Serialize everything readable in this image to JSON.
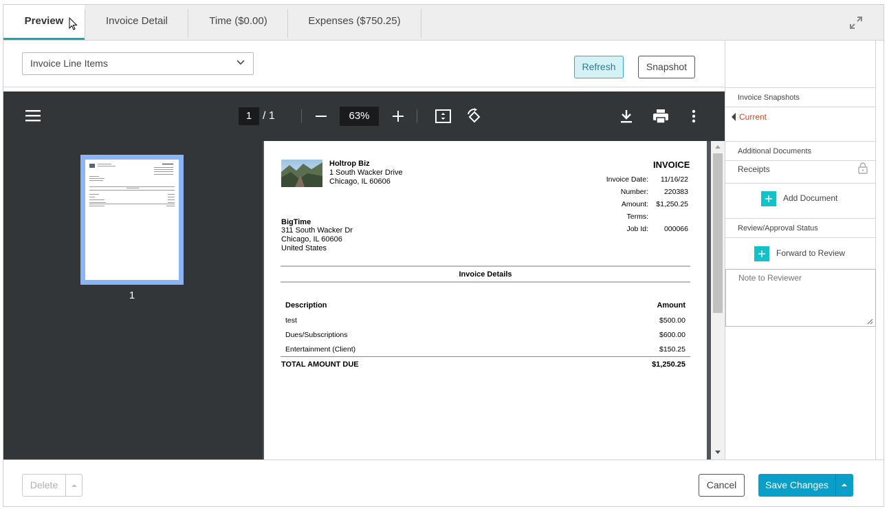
{
  "tabs": [
    {
      "label": "Preview"
    },
    {
      "label": "Invoice Detail"
    },
    {
      "label": "Time ($0.00)"
    },
    {
      "label": "Expenses ($750.25)"
    }
  ],
  "toolbar": {
    "view_select": "Invoice Line Items",
    "refresh_label": "Refresh",
    "snapshot_label": "Snapshot"
  },
  "viewer": {
    "page_current": "1",
    "page_total": "/ 1",
    "zoom": "63%",
    "thumb_label": "1"
  },
  "invoice": {
    "company_name": "Holtrop Biz",
    "company_addr1": "1 South Wacker Drive",
    "company_addr2": "Chicago, IL 60606",
    "title": "INVOICE",
    "meta": [
      {
        "label": "Invoice Date:",
        "value": "11/16/22"
      },
      {
        "label": "Number:",
        "value": "220383"
      },
      {
        "label": "Amount:",
        "value": "$1,250.25"
      },
      {
        "label": "Terms:",
        "value": ""
      },
      {
        "label": "Job Id:",
        "value": "000066"
      }
    ],
    "bill_name": "BigTime",
    "bill_lines": [
      "311 South Wacker Dr",
      "Chicago, IL 60606",
      "United States"
    ],
    "details_heading": "Invoice Details",
    "col_description": "Description",
    "col_amount": "Amount",
    "rows": [
      {
        "description": "test",
        "amount": "$500.00"
      },
      {
        "description": "Dues/Subscriptions",
        "amount": "$600.00"
      },
      {
        "description": "Entertainment (Client)",
        "amount": "$150.25"
      }
    ],
    "total_label": "TOTAL AMOUNT DUE",
    "total_value": "$1,250.25"
  },
  "sidebar": {
    "snapshots_header": "Invoice Snapshots",
    "current_label": "Current",
    "additional_header": "Additional Documents",
    "receipts_label": "Receipts",
    "add_document_label": "Add Document",
    "review_header": "Review/Approval Status",
    "forward_label": "Forward to Review",
    "note_placeholder": "Note to Reviewer"
  },
  "footer": {
    "delete_label": "Delete",
    "cancel_label": "Cancel",
    "save_label": "Save Changes"
  },
  "colors": {
    "accent": "#1aa6b7",
    "save": "#0a9fc9",
    "current": "#c8472a"
  }
}
